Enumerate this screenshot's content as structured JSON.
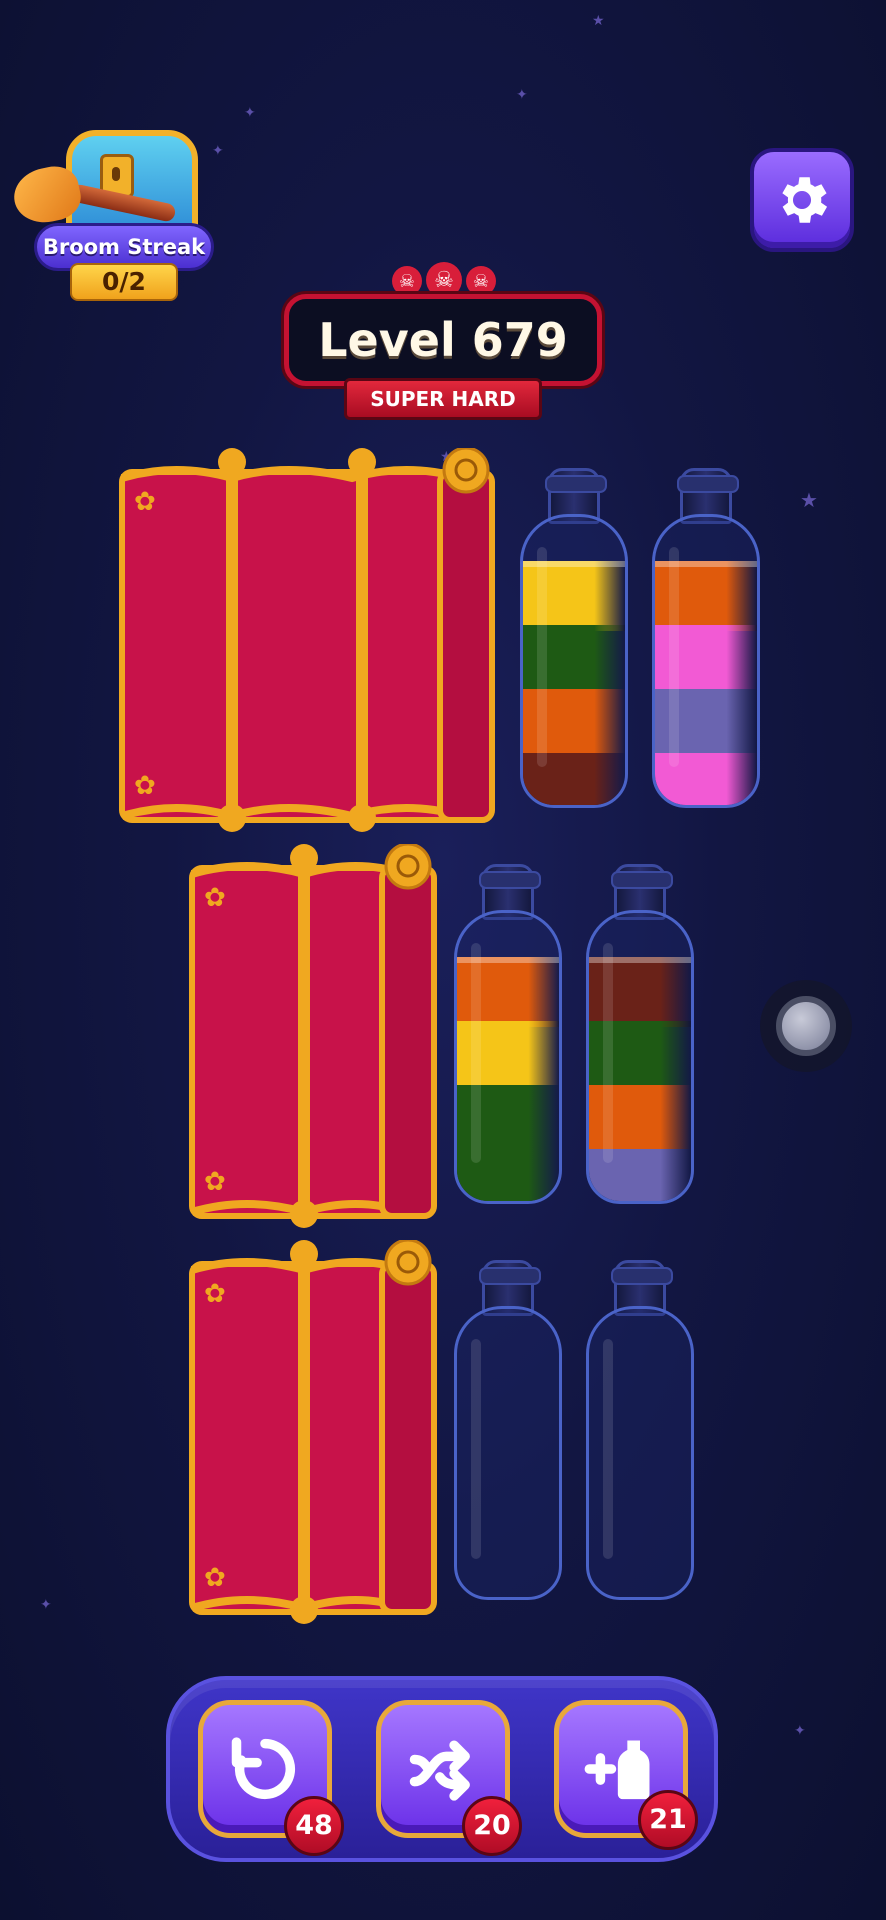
{
  "streak": {
    "label": "Broom Streak",
    "count": "0/2"
  },
  "level": {
    "title": "Level 679",
    "difficulty": "SUPER HARD"
  },
  "colors": {
    "yellow": "#f5c518",
    "green": "#1e5a14",
    "orange": "#e05a0c",
    "brown": "#6a2218",
    "pink": "#f25ad4",
    "lavender": "#6a64b0",
    "curtain": "#c8124a",
    "gold": "#f0a820"
  },
  "bottles": [
    {
      "row": 1,
      "layers_top_to_bottom": [
        "yellow",
        "green",
        "orange",
        "brown"
      ]
    },
    {
      "row": 1,
      "layers_top_to_bottom": [
        "orange",
        "pink",
        "lavender",
        "pink"
      ]
    },
    {
      "row": 2,
      "layers_top_to_bottom": [
        "orange",
        "yellow",
        "green",
        "green"
      ]
    },
    {
      "row": 2,
      "layers_top_to_bottom": [
        "brown",
        "green",
        "orange",
        "lavender"
      ]
    },
    {
      "row": 3,
      "layers_top_to_bottom": []
    },
    {
      "row": 3,
      "layers_top_to_bottom": []
    }
  ],
  "powerups": [
    {
      "name": "undo",
      "icon": "undo-icon",
      "count": "48"
    },
    {
      "name": "shuffle",
      "icon": "shuffle-icon",
      "count": "20"
    },
    {
      "name": "add-bottle",
      "icon": "add-bottle-icon",
      "count": "21"
    }
  ]
}
